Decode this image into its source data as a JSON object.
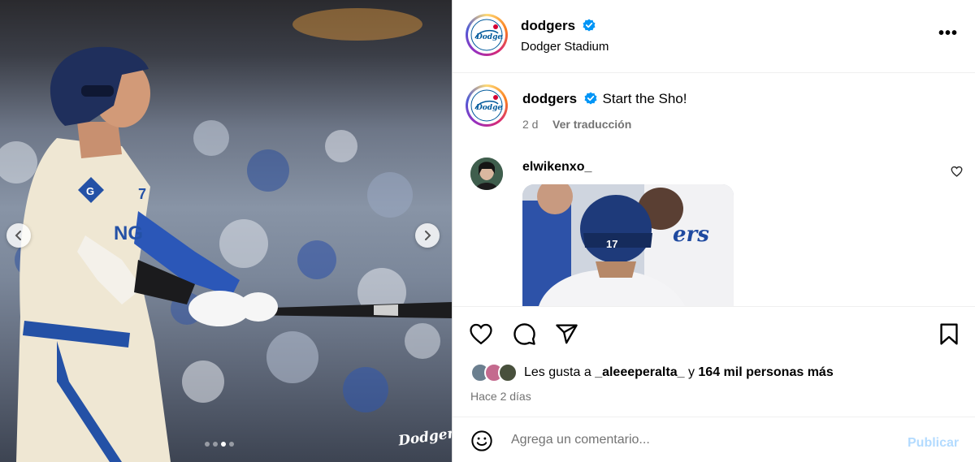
{
  "post": {
    "username": "dodgers",
    "location": "Dodger Stadium",
    "more_label": "•••",
    "caption_text": "Start the Sho!",
    "time_ago": "2 d",
    "translate_label": "Ver traducción",
    "watermark": "Dodgers",
    "carousel": {
      "total": 4,
      "active_index": 2
    }
  },
  "comment": {
    "username": "elwikenxo_"
  },
  "likes": {
    "prefix": "Les gusta a",
    "liker": "_aleeeperalta_",
    "joiner": "y",
    "others": "164 mil personas más"
  },
  "posted_label": "Hace 2 días",
  "composer": {
    "placeholder": "Agrega un comentario...",
    "publish_label": "Publicar"
  },
  "colors": {
    "verified_blue": "#0095f6",
    "secondary_text": "#737373",
    "publish_disabled": "#b3dbff",
    "dodger_blue": "#005a9c"
  }
}
